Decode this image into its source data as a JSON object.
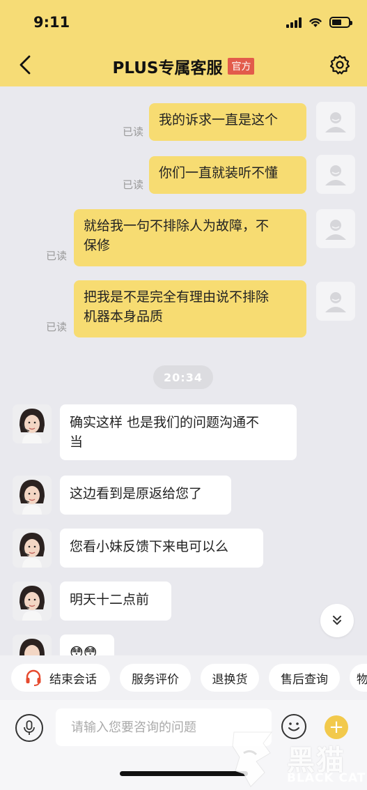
{
  "status_bar": {
    "time": "9:11"
  },
  "header": {
    "title": "PLUS专属客服",
    "badge": "官方"
  },
  "read_label": "已读",
  "messages_out": [
    {
      "lines": [
        "我的诉求一直是这个"
      ]
    },
    {
      "lines": [
        "你们一直就装听不懂"
      ]
    },
    {
      "lines": [
        "就给我一句不排除人为故障，不",
        "保修"
      ]
    },
    {
      "lines": [
        "把我是不是完全有理由说不排除",
        "机器本身品质"
      ]
    }
  ],
  "time_divider": "20:34",
  "messages_in": [
    {
      "lines": [
        "确实这样 也是我们的问题沟通不",
        "当"
      ]
    },
    {
      "lines": [
        "这边看到是原返给您了"
      ]
    },
    {
      "lines": [
        "您看小妹反馈下来电可以么"
      ]
    },
    {
      "lines": [
        "明天十二点前"
      ]
    },
    {
      "lines": [
        "😳😳"
      ]
    }
  ],
  "quick_actions": [
    "结束会话",
    "服务评价",
    "退换货",
    "售后查询",
    "物"
  ],
  "input": {
    "placeholder": "请输入您要咨询的问题"
  },
  "watermark": {
    "cn": "黑猫",
    "en": "BLACK CAT"
  },
  "colors": {
    "header_bg": "#f6dc76",
    "bubble_out": "#f7dc72",
    "badge": "#e25b4b",
    "chat_bg": "#e9e9ee"
  }
}
